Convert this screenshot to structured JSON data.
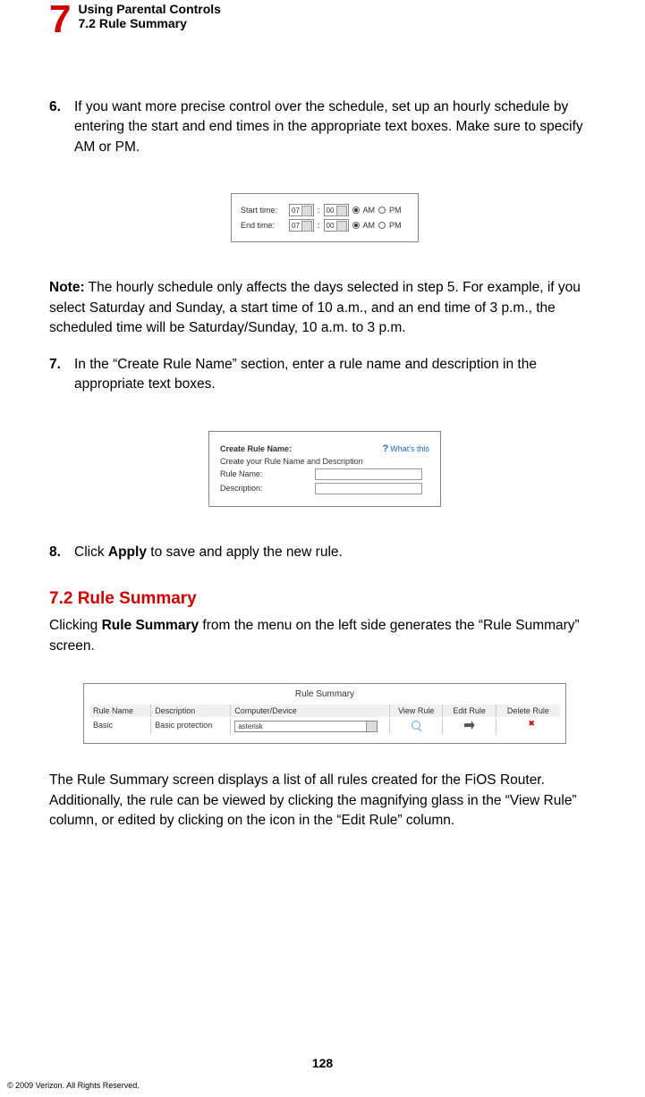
{
  "header": {
    "chapter_number": "7",
    "title": "Using Parental Controls",
    "subtitle": "7.2  Rule Summary"
  },
  "steps": {
    "s6": {
      "num": "6.",
      "body": "If you want more precise control over the schedule, set up an hourly schedule by entering the start and end times in the appropriate text boxes. Make sure to specify AM or PM."
    },
    "s7": {
      "num": "7.",
      "body": "In the “Create Rule Name” section, enter a rule name and description in the appropriate text boxes."
    },
    "s8": {
      "num": "8.",
      "prefix": "Click ",
      "bold": "Apply",
      "suffix": " to save and apply the new rule."
    }
  },
  "note": {
    "label": "Note:",
    "body": " The hourly schedule only affects the days selected in step 5. For example, if you select Saturday and Sunday, a start time of 10 a.m., and an end time of 3 p.m., the scheduled time will be Saturday/Sunday, 10 a.m. to 3 p.m."
  },
  "section": {
    "heading": "7.2  Rule Summary",
    "para1_a": "Clicking ",
    "para1_bold": "Rule Summary",
    "para1_b": " from the menu on the left side generates the “Rule Summary” screen.",
    "para2": "The Rule Summary screen displays a list of all rules created for the FiOS Router. Additionally, the rule can be viewed by clicking the magnifying glass in the “View Rule” column, or edited by clicking on the icon in the “Edit Rule” column."
  },
  "fig1": {
    "start_label": "Start time:",
    "end_label": "End time:",
    "hour": "07",
    "min": "00",
    "am": "AM",
    "pm": "PM"
  },
  "fig2": {
    "title": "Create Rule Name:",
    "whats": "What's this",
    "sub": "Create your Rule Name and Description",
    "rule_name_lbl": "Rule Name:",
    "desc_lbl": "Description:"
  },
  "fig3": {
    "title": "Rule Summary",
    "headers": {
      "name": "Rule Name",
      "desc": "Description",
      "dev": "Computer/Device",
      "view": "View Rule",
      "edit": "Edit Rule",
      "del": "Delete Rule"
    },
    "row": {
      "name": "Basic",
      "desc": "Basic protection",
      "dev": "asterisk"
    }
  },
  "page_number": "128",
  "copyright": "© 2009 Verizon. All Rights Reserved."
}
